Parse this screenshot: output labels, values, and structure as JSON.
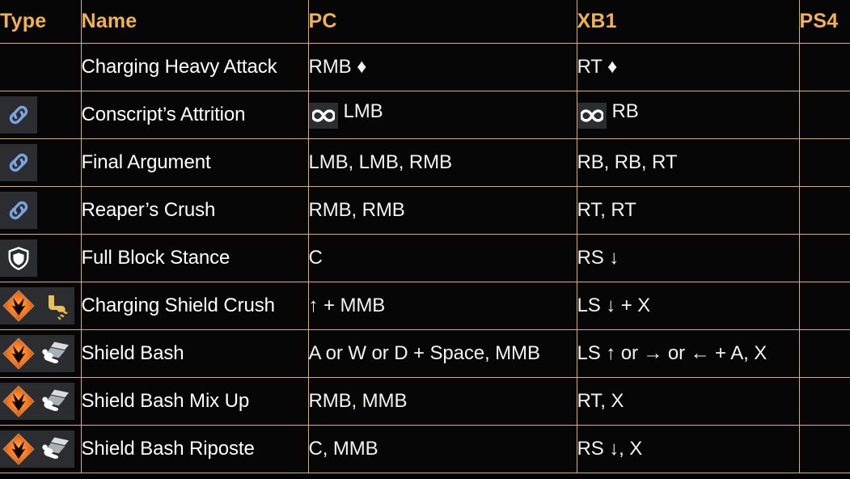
{
  "table": {
    "columns": [
      {
        "key": "type",
        "label": "Type"
      },
      {
        "key": "name",
        "label": "Name"
      },
      {
        "key": "pc",
        "label": "PC"
      },
      {
        "key": "xb1",
        "label": "XB1"
      },
      {
        "key": "ps4",
        "label": "PS4"
      }
    ],
    "rows": [
      {
        "icons": [],
        "name": "Charging Heavy Attack",
        "pc": "RMB ♦",
        "pc_badge": "none",
        "xb1": "RT ♦",
        "xb1_badge": "none",
        "ps4": ""
      },
      {
        "icons": [
          "chain-link-icon"
        ],
        "name": "Conscript’s Attrition",
        "pc": "LMB",
        "pc_badge": "infinity-icon",
        "xb1": "RB",
        "xb1_badge": "infinity-icon",
        "ps4": ""
      },
      {
        "icons": [
          "chain-link-icon"
        ],
        "name": "Final Argument",
        "pc": "LMB, LMB, RMB",
        "pc_badge": "none",
        "xb1": "RB, RB, RT",
        "xb1_badge": "none",
        "ps4": ""
      },
      {
        "icons": [
          "chain-link-icon"
        ],
        "name": "Reaper’s Crush",
        "pc": "RMB, RMB",
        "pc_badge": "none",
        "xb1": "RT, RT",
        "xb1_badge": "none",
        "ps4": ""
      },
      {
        "icons": [
          "shield-stance-icon"
        ],
        "name": "Full Block Stance",
        "pc": "C",
        "pc_badge": "none",
        "xb1": "RS ↓",
        "xb1_badge": "none",
        "ps4": ""
      },
      {
        "icons": [
          "unblockable-icon",
          "kick-boot-icon"
        ],
        "name": "Charging Shield Crush",
        "pc": "↑ + MMB",
        "pc_badge": "none",
        "xb1": "LS ↓ + X",
        "xb1_badge": "none",
        "ps4": ""
      },
      {
        "icons": [
          "unblockable-icon",
          "shield-bash-icon"
        ],
        "name": "Shield Bash",
        "pc": "A or W or D + Space, MMB",
        "pc_badge": "none",
        "xb1": "LS ↑ or → or ← + A, X",
        "xb1_badge": "none",
        "ps4": ""
      },
      {
        "icons": [
          "unblockable-icon",
          "shield-bash-icon"
        ],
        "name": "Shield Bash Mix Up",
        "pc": "RMB, MMB",
        "pc_badge": "none",
        "xb1": "RT, X",
        "xb1_badge": "none",
        "ps4": ""
      },
      {
        "icons": [
          "unblockable-icon",
          "shield-bash-icon"
        ],
        "name": "Shield Bash Riposte",
        "pc": "C, MMB",
        "pc_badge": "none",
        "xb1": "RS ↓, X",
        "xb1_badge": "none",
        "ps4": ""
      }
    ]
  },
  "colors": {
    "border": "#e0aa6a",
    "header_text": "#f0b252",
    "body_text": "#ffffff",
    "background": "#050505",
    "icon_tile": "#2b2d30",
    "chain_blue": "#7ba3dd",
    "unblockable_orange": "#f2711c",
    "boot_gold": "#e8c05a",
    "bash_white": "#f2f2f2"
  }
}
